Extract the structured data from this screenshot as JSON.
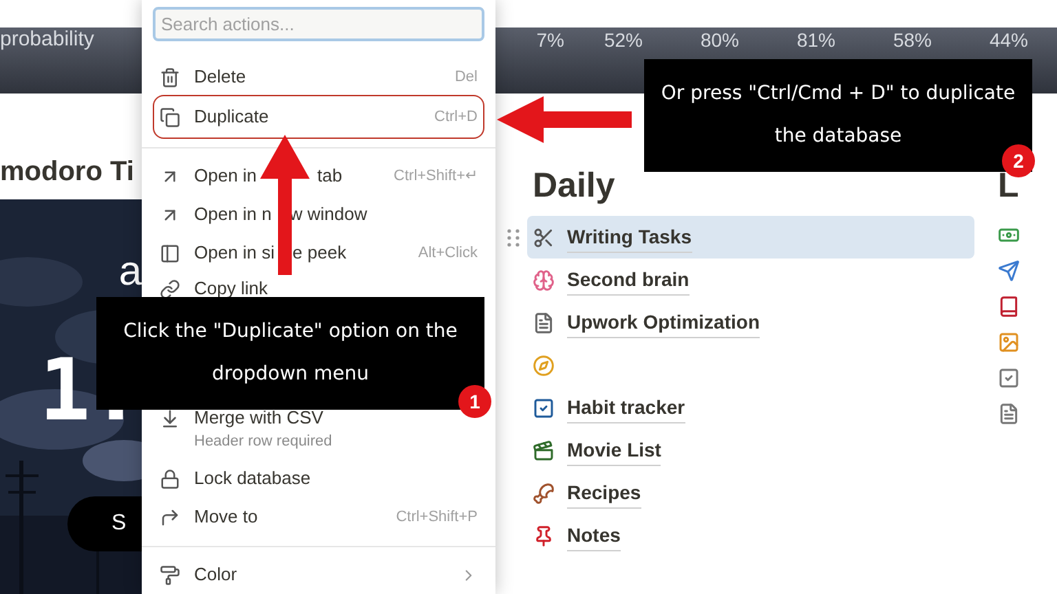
{
  "stats_bar": {
    "label": "probability",
    "values": [
      "7%",
      "52%",
      "80%",
      "81%",
      "58%",
      "44%"
    ]
  },
  "pomodoro": {
    "title": "modoro Ti",
    "greeting": "a",
    "timer": "1:",
    "button": "S",
    "kind": "picture"
  },
  "menu": {
    "search": {
      "placeholder": "Search actions..."
    },
    "items": [
      {
        "kind": "item",
        "label": "Delete",
        "shortcut": "Del",
        "outlined": false
      },
      {
        "kind": "item",
        "label": "Duplicate",
        "shortcut": "Ctrl+D",
        "outlined": true
      },
      {
        "kind": "divider"
      },
      {
        "kind": "item",
        "label": "Open in",
        "label_rest": "tab",
        "shortcut": "Ctrl+Shift+↵",
        "outlined": false
      },
      {
        "kind": "item",
        "label": "Open in n",
        "label_rest": "w window",
        "outlined": false
      },
      {
        "kind": "item",
        "label": "Open in si",
        "label_rest": "e peek",
        "shortcut": "Alt+Click",
        "outlined": false
      },
      {
        "kind": "item",
        "label": "Copy link",
        "outlined": false
      },
      {
        "kind": "gap"
      },
      {
        "kind": "item",
        "label": "Merge with CSV",
        "sublabel": "Header row required",
        "outlined": false
      },
      {
        "kind": "item",
        "label": "Lock database",
        "outlined": false
      },
      {
        "kind": "item",
        "label": "Move to",
        "shortcut": "Ctrl+Shift+P",
        "outlined": false
      },
      {
        "kind": "divider"
      },
      {
        "kind": "submenu",
        "label": "Color",
        "outlined": false
      }
    ]
  },
  "daily": {
    "title": "Daily",
    "items": [
      {
        "label": "Writing Tasks",
        "selected": true
      },
      {
        "label": "Second brain",
        "selected": false
      },
      {
        "label": "Upwork Optimization",
        "selected": false
      },
      {
        "selected": false
      },
      {
        "label": "Habit tracker",
        "selected": false
      },
      {
        "label": "Movie List",
        "selected": false
      },
      {
        "label": "Recipes",
        "selected": false
      },
      {
        "label": "Notes",
        "selected": false
      }
    ]
  },
  "right_column": {
    "title": "L"
  },
  "callouts": [
    {
      "text": "Click the \"Duplicate\" option on the dropdown menu",
      "step": "1"
    },
    {
      "text": "Or press \"Ctrl/Cmd + D\" to duplicate the database",
      "step": "2"
    }
  ]
}
